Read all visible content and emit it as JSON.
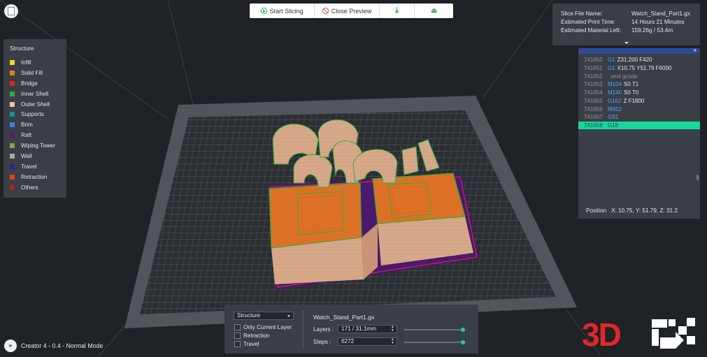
{
  "toolbar": {
    "start_label": "Start Slicing",
    "close_label": "Close Preview"
  },
  "legend": {
    "title": "Structure",
    "items": [
      {
        "label": "Infill",
        "color": "#f5d327"
      },
      {
        "label": "Solid Fill",
        "color": "#f07a1e"
      },
      {
        "label": "Bridge",
        "color": "#e0261c"
      },
      {
        "label": "Inner Shell",
        "color": "#2fae3a"
      },
      {
        "label": "Outer Shell",
        "color": "#f2bfa0"
      },
      {
        "label": "Supports",
        "color": "#1a8f8f"
      },
      {
        "label": "Brim",
        "color": "#3f7fe6"
      },
      {
        "label": "Raft",
        "color": "#5a1a7a"
      },
      {
        "label": "Wiping Tower",
        "color": "#9c9a4e"
      },
      {
        "label": "Wall",
        "color": "#a8a8a8"
      },
      {
        "label": "Travel",
        "color": "#27288e"
      },
      {
        "label": "Retraction",
        "color": "#e0421c"
      },
      {
        "label": "Others",
        "color": "#a0292a"
      }
    ]
  },
  "slice_info": {
    "file_name_label": "Slice File Name:",
    "file_name": "Watch_Stand_Part1.gx",
    "print_time_label": "Estimated Print Time:",
    "print_time": "14 Hours 21 Minutes",
    "material_label": "Estimated Material Left:",
    "material": "159.26g / 53.4m"
  },
  "gcode": {
    "lines": [
      {
        "num": "741650",
        "cmd": "G1",
        "args": "Z31.200 F420"
      },
      {
        "num": "741651",
        "cmd": "G1",
        "args": "X10.75 Y51.79 F6000"
      },
      {
        "num": "741652",
        "cmd": "",
        "args": ";end gcode"
      },
      {
        "num": "741653",
        "cmd": "M104",
        "args": "S0 T1"
      },
      {
        "num": "741654",
        "cmd": "M140",
        "args": "S0 T0"
      },
      {
        "num": "741655",
        "cmd": "G162",
        "args": "Z F1800"
      },
      {
        "num": "741656",
        "cmd": "M652",
        "args": ""
      },
      {
        "num": "741657",
        "cmd": "G91",
        "args": ""
      },
      {
        "num": "741658",
        "cmd": "G18",
        "args": ""
      }
    ],
    "position_label": "Position",
    "position_value": "X: 10.75, Y: 51.79, Z: 31.2"
  },
  "layer_panel": {
    "structure_select": "Structure",
    "only_current_layer": "Only Current Layer",
    "retraction": "Retraction",
    "travel": "Travel",
    "file_name": "Watch_Stand_Part1.gx",
    "layers_label": "Layers :",
    "layers_value": "171 / 31.1mm",
    "steps_label": "Steps :",
    "steps_value": "6272",
    "layers_fraction": 1.0,
    "steps_fraction": 1.0
  },
  "mode": {
    "label": "Creator 4 - 0.4 - Normal Mode"
  },
  "logo": {
    "text": "3D"
  }
}
